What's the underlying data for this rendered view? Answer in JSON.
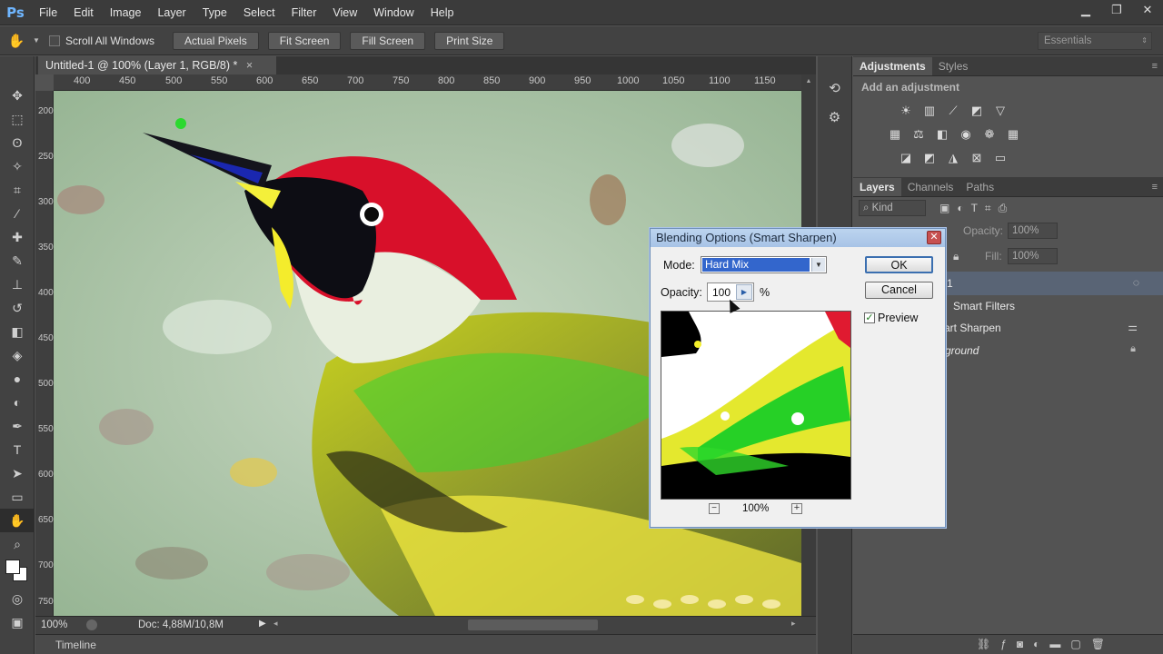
{
  "app": {
    "logo": "Ps"
  },
  "menu": [
    "File",
    "Edit",
    "Image",
    "Layer",
    "Type",
    "Select",
    "Filter",
    "View",
    "Window",
    "Help"
  ],
  "options_bar": {
    "scroll_all_windows": "Scroll All Windows",
    "actual_pixels": "Actual Pixels",
    "fit_screen": "Fit Screen",
    "fill_screen": "Fill Screen",
    "print_size": "Print Size",
    "workspace": "Essentials"
  },
  "document": {
    "tab_title": "Untitled-1 @ 100% (Layer 1, RGB/8) *",
    "close_glyph": "×",
    "ruler_h": [
      "400",
      "450",
      "500",
      "550",
      "600",
      "650",
      "700",
      "750",
      "800",
      "850",
      "900",
      "950",
      "1000",
      "1050",
      "1100",
      "1150"
    ],
    "ruler_v": [
      "200",
      "250",
      "300",
      "350",
      "400",
      "450",
      "500",
      "550",
      "600",
      "650",
      "700",
      "750"
    ]
  },
  "status": {
    "zoom": "100%",
    "doc_info": "Doc: 4,88M/10,8M"
  },
  "timeline": {
    "label": "Timeline"
  },
  "adjustments": {
    "tab_adjustments": "Adjustments",
    "tab_styles": "Styles",
    "hint": "Add an adjustment"
  },
  "layers": {
    "tab_layers": "Layers",
    "tab_channels": "Channels",
    "tab_paths": "Paths",
    "filter_kind": "Kind",
    "opacity_label": "Opacity:",
    "opacity_value": "100%",
    "fill_label": "Fill:",
    "fill_value": "100%",
    "items": [
      {
        "name": "1"
      },
      {
        "name": "Smart Filters"
      },
      {
        "name": "art Sharpen"
      },
      {
        "name": "ground"
      }
    ]
  },
  "dialog": {
    "title": "Blending Options (Smart Sharpen)",
    "mode_label": "Mode:",
    "mode_value": "Hard Mix",
    "opacity_label": "Opacity:",
    "opacity_value": "100",
    "opacity_unit": "%",
    "ok": "OK",
    "cancel": "Cancel",
    "preview_label": "Preview",
    "preview_checked": true,
    "zoom_value": "100%"
  },
  "colors": {
    "ui_dark": "#3b3b3b",
    "panel_bg": "#535353",
    "dialog_bg": "#f0f0f0",
    "mode_select": "#3366cc",
    "accent_link": "#6fb6ff"
  }
}
